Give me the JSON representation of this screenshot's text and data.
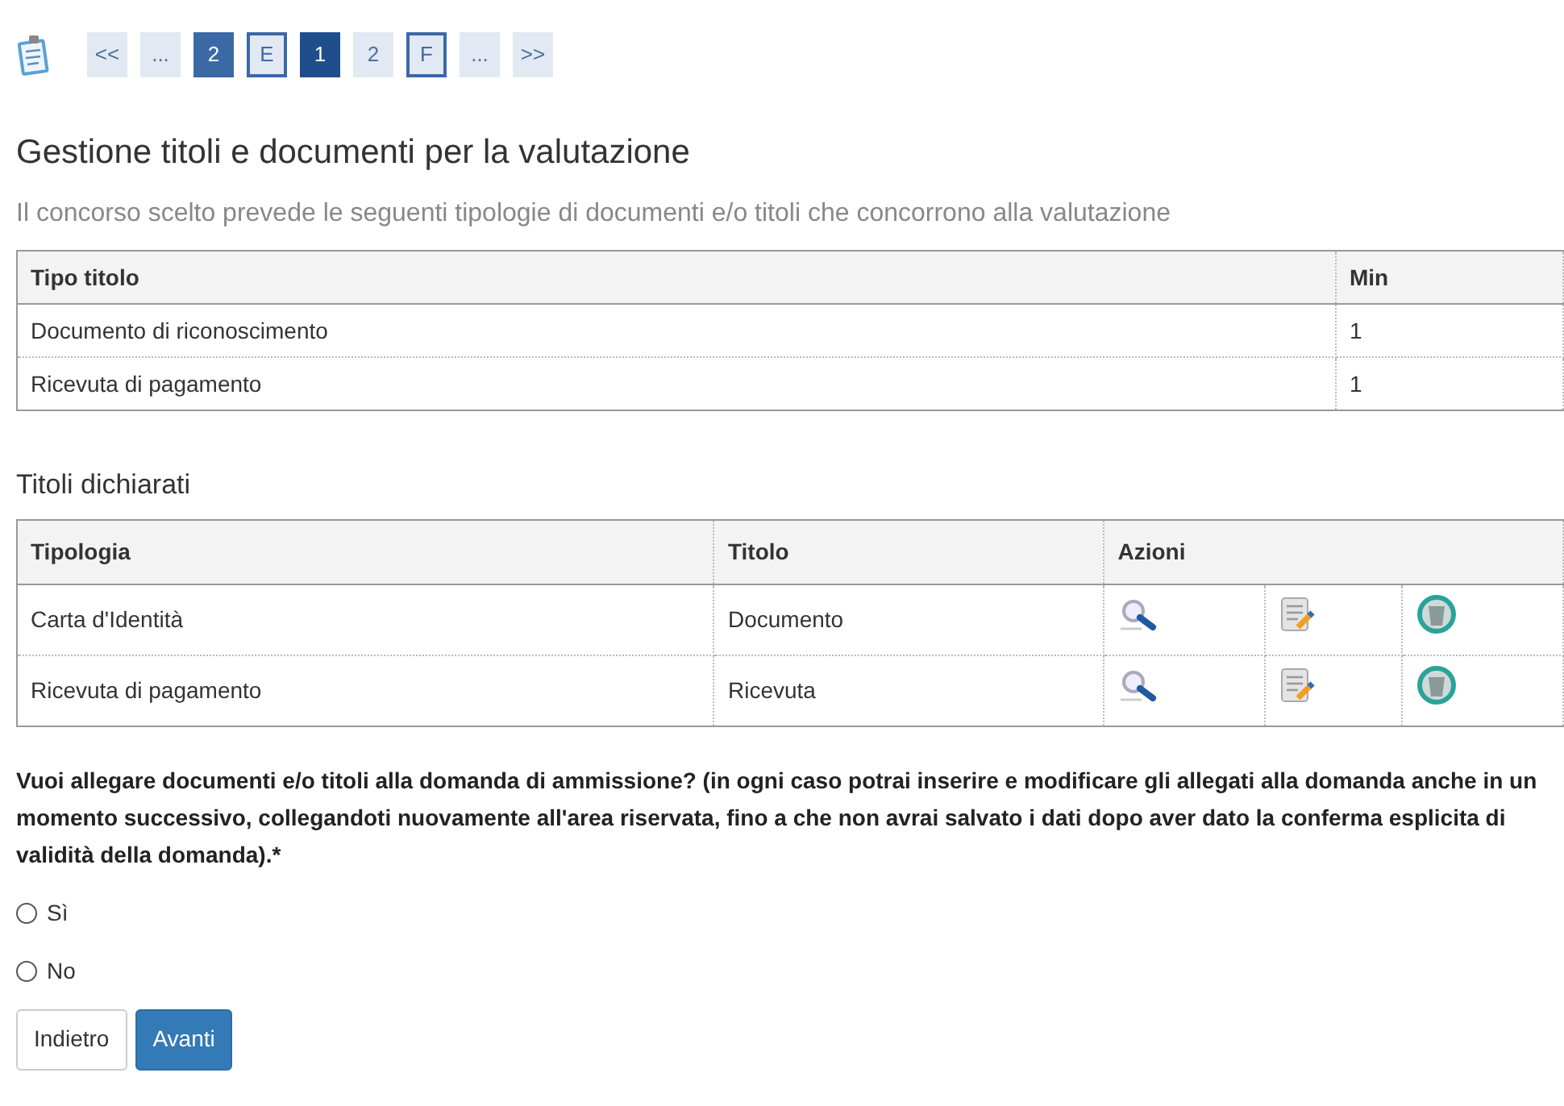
{
  "steps": [
    {
      "label": "<<",
      "kind": "plain",
      "selected": false
    },
    {
      "label": "...",
      "kind": "plain",
      "selected": false
    },
    {
      "label": "2",
      "kind": "filled",
      "selected": false
    },
    {
      "label": "E",
      "kind": "outlined",
      "selected": false
    },
    {
      "label": "1",
      "kind": "filled",
      "selected": true
    },
    {
      "label": "2",
      "kind": "plain",
      "selected": false
    },
    {
      "label": "F",
      "kind": "outlined",
      "selected": false
    },
    {
      "label": "...",
      "kind": "plain",
      "selected": false
    },
    {
      "label": ">>",
      "kind": "plain",
      "selected": false
    }
  ],
  "title": "Gestione titoli e documenti per la valutazione",
  "subtitle": "Il concorso scelto prevede le seguenti tipologie di documenti e/o titoli che concorrono alla valutazione",
  "required_table": {
    "columns": [
      "Tipo titolo",
      "Min"
    ],
    "rows": [
      [
        "Documento di riconoscimento",
        "1"
      ],
      [
        "Ricevuta di pagamento",
        "1"
      ]
    ]
  },
  "declared_title": "Titoli dichiarati",
  "declared_table": {
    "columns": [
      "Tipologia",
      "Titolo",
      "Azioni"
    ],
    "rows": [
      {
        "tipologia": "Carta d'Identità",
        "titolo": "Documento"
      },
      {
        "tipologia": "Ricevuta di pagamento",
        "titolo": "Ricevuta"
      }
    ]
  },
  "question": "Vuoi allegare documenti e/o titoli alla domanda di ammissione? (in ogni caso potrai inserire e modificare gli allegati alla domanda anche in un momento successivo, collegandoti nuovamente all'area riservata, fino a che non avrai salvato i dati dopo aver dato la conferma esplicita di validità della domanda).*",
  "options": [
    {
      "label": "Sì",
      "selected": false
    },
    {
      "label": "No",
      "selected": false
    }
  ],
  "buttons": [
    {
      "label": "Indietro",
      "kind": "secondary"
    },
    {
      "label": "Avanti",
      "kind": "primary"
    }
  ]
}
